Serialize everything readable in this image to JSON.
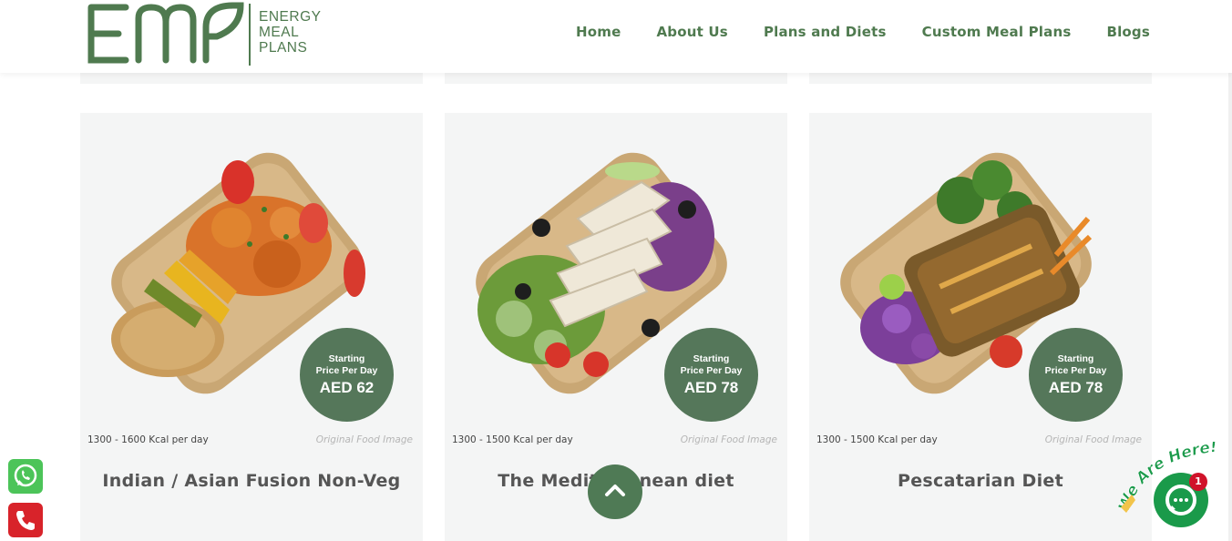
{
  "logo": {
    "lines": [
      "ENERGY",
      "MEAL",
      "PLANS"
    ]
  },
  "nav": {
    "items": [
      "Home",
      "About Us",
      "Plans and Diets",
      "Custom Meal Plans",
      "Blogs"
    ]
  },
  "cards": [
    {
      "badge_line1": "Starting",
      "badge_line2": "Price Per Day",
      "price": "AED 62",
      "kcal": "1300 - 1600 Kcal per day",
      "note": "Original Food Image",
      "title": "Indian / Asian Fusion Non-Veg"
    },
    {
      "badge_line1": "Starting",
      "badge_line2": "Price Per Day",
      "price": "AED 78",
      "kcal": "1300 - 1500 Kcal per day",
      "note": "Original Food Image",
      "title": "The Mediterranean diet"
    },
    {
      "badge_line1": "Starting",
      "badge_line2": "Price Per Day",
      "price": "AED 78",
      "kcal": "1300 - 1500 Kcal per day",
      "note": "Original Food Image",
      "title": "Pescatarian Diet"
    }
  ],
  "chat": {
    "banner": "We Are Here!",
    "unread_count": "1"
  },
  "colors": {
    "brand_green": "#4f7a4f",
    "badge_green": "#55775a",
    "card_bg": "#f4f5f5",
    "whatsapp": "#4cc459",
    "phone": "#d8232a",
    "chat": "#1a9a4a"
  },
  "icons": [
    "whatsapp-icon",
    "phone-icon",
    "chevron-up-icon",
    "chat-bubble-icon"
  ]
}
